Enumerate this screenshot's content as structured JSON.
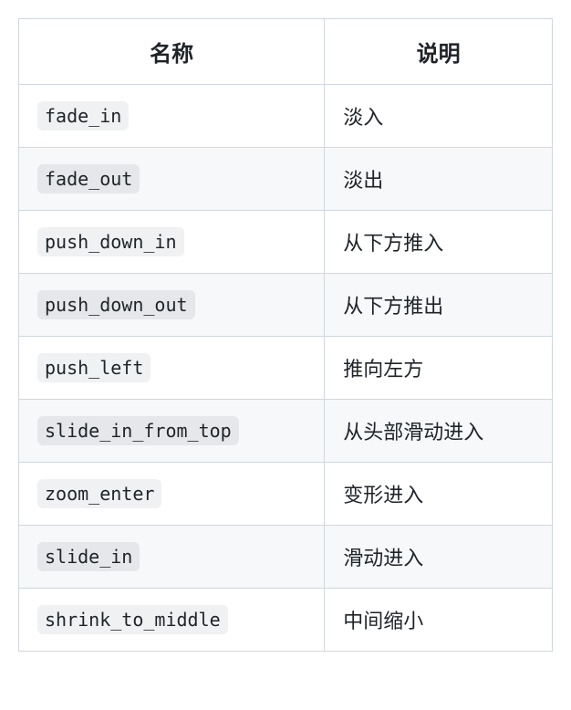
{
  "headers": {
    "name": "名称",
    "description": "说明"
  },
  "rows": [
    {
      "name": "fade_in",
      "description": "淡入"
    },
    {
      "name": "fade_out",
      "description": "淡出"
    },
    {
      "name": "push_down_in",
      "description": "从下方推入"
    },
    {
      "name": "push_down_out",
      "description": "从下方推出"
    },
    {
      "name": "push_left",
      "description": "推向左方"
    },
    {
      "name": "slide_in_from_top",
      "description": "从头部滑动进入"
    },
    {
      "name": "zoom_enter",
      "description": "变形进入"
    },
    {
      "name": "slide_in",
      "description": "滑动进入"
    },
    {
      "name": "shrink_to_middle",
      "description": "中间缩小"
    }
  ]
}
